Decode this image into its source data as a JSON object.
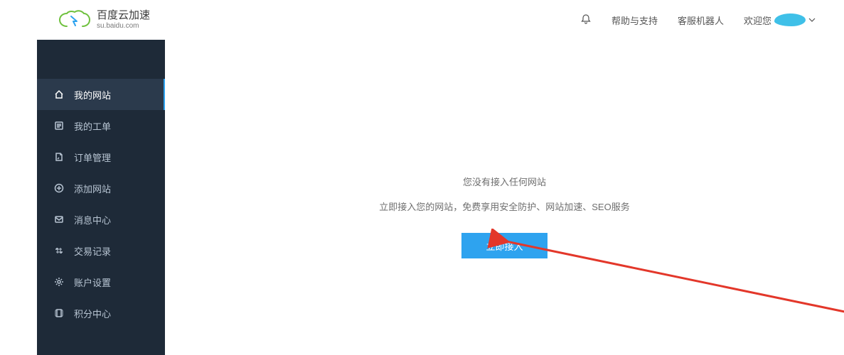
{
  "header": {
    "logo_title": "百度云加速",
    "logo_sub": "su.baidu.com",
    "help_label": "帮助与支持",
    "robot_label": "客服机器人",
    "welcome_label": "欢迎您",
    "user_masked": ""
  },
  "sidebar": {
    "items": [
      {
        "label": "我的网站",
        "icon": "home-icon",
        "active": true
      },
      {
        "label": "我的工单",
        "icon": "ticket-icon",
        "active": false
      },
      {
        "label": "订单管理",
        "icon": "order-icon",
        "active": false
      },
      {
        "label": "添加网站",
        "icon": "plus-circle-icon",
        "active": false
      },
      {
        "label": "消息中心",
        "icon": "message-icon",
        "active": false
      },
      {
        "label": "交易记录",
        "icon": "transaction-icon",
        "active": false
      },
      {
        "label": "账户设置",
        "icon": "settings-icon",
        "active": false
      },
      {
        "label": "积分中心",
        "icon": "points-icon",
        "active": false
      }
    ]
  },
  "main": {
    "message1": "您没有接入任何网站",
    "message2": "立即接入您的网站，免费享用安全防护、网站加速、SEO服务",
    "cta_label": "立即接入"
  }
}
